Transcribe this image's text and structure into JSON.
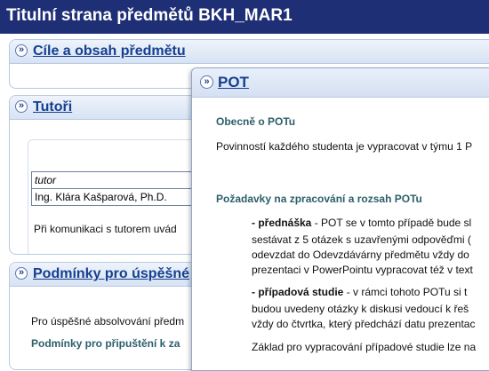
{
  "header": {
    "title": "Titulní strana předmětů BKH_MAR1"
  },
  "panels": {
    "cile": {
      "title": "Cíle a obsah předmětu"
    },
    "tutori": {
      "title": "Tutoři",
      "table_header": "tutor",
      "tutor_name": "Ing. Klára Kašparová, Ph.D.",
      "note": "Při komunikaci s tutorem uvád"
    },
    "podminky": {
      "title": "Podmínky pro úspěšné",
      "text": "Pro úspěšné absolvování předm",
      "subheading": "Podmínky pro připuštění k za"
    }
  },
  "modal": {
    "title": "POT",
    "section1_heading": "Obecně o POTu",
    "section1_text": "Povinností každého studenta je vypracovat v týmu 1 P",
    "section2_heading": "Požadavky na zpracování a rozsah POTu",
    "item1_label": "- přednáška",
    "item1_line1": " - POT se v tomto případě bude sl",
    "item1_line2": "sestávat z 5 otázek s uzavřenými odpověďmi (",
    "item1_line3": "odevzdat do Odevzdávárny předmětu vždy do",
    "item1_line4": "prezentaci v PowerPointu vypracovat též v text",
    "item2_label": "- případová studie",
    "item2_line1": " - v rámci tohoto POTu si t",
    "item2_line2": "budou uvedeny otázky k diskusi vedoucí k řeš",
    "item2_line3": "vždy do čtvrtka, který předchází datu prezentac",
    "footer_text": "Základ pro vypracování případové studie lze na"
  },
  "colors": {
    "header_bg": "#1e2f76",
    "link": "#153f8f",
    "section_heading": "#2b5f6b"
  }
}
